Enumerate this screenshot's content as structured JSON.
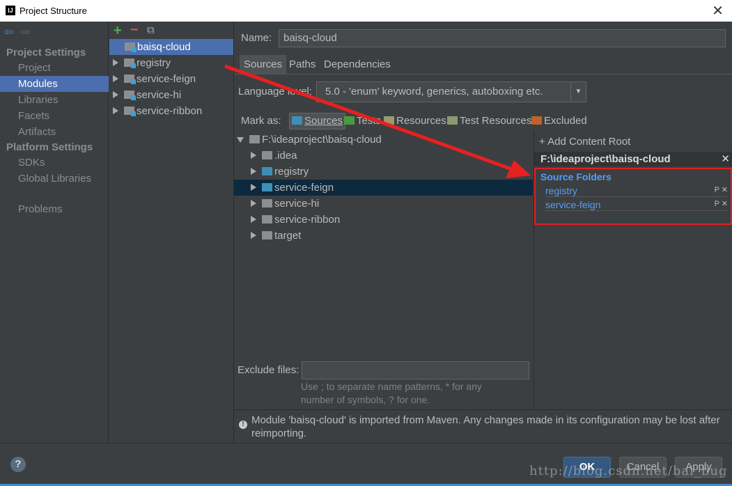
{
  "window": {
    "title": "Project Structure"
  },
  "sidebar": {
    "section1": "Project Settings",
    "items1": [
      "Project",
      "Modules",
      "Libraries",
      "Facets",
      "Artifacts"
    ],
    "section2": "Platform Settings",
    "items2": [
      "SDKs",
      "Global Libraries"
    ],
    "problems": "Problems"
  },
  "modules": {
    "items": [
      "baisq-cloud",
      "registry",
      "service-feign",
      "service-hi",
      "service-ribbon"
    ]
  },
  "main": {
    "name_label": "Name:",
    "name_value": "baisq-cloud",
    "tabs": [
      "Sources",
      "Paths",
      "Dependencies"
    ],
    "language_label": "Language level:",
    "language_value": "5.0 - 'enum' keyword, generics, autoboxing etc.",
    "mark_as": "Mark as:",
    "marks": [
      "Sources",
      "Tests",
      "Resources",
      "Test Resources",
      "Excluded"
    ],
    "tree": [
      "F:\\ideaproject\\baisq-cloud",
      ".idea",
      "registry",
      "service-feign",
      "service-hi",
      "service-ribbon",
      "target"
    ],
    "exclude_label": "Exclude files:",
    "exclude_hint": "Use ; to separate name patterns, * for any number of symbols, ? for one.",
    "info": "Module 'baisq-cloud' is imported from Maven. Any changes made in its configuration may be lost after reimporting."
  },
  "roots": {
    "add": "+ Add Content Root",
    "root": "F:\\ideaproject\\baisq-cloud",
    "source_folders": "Source Folders",
    "folders": [
      "registry",
      "service-feign"
    ]
  },
  "footer": {
    "help": "?",
    "ok": "OK",
    "cancel": "Cancel",
    "apply": "Apply",
    "watermark": "http://blog.csdn.net/bai_bug"
  }
}
